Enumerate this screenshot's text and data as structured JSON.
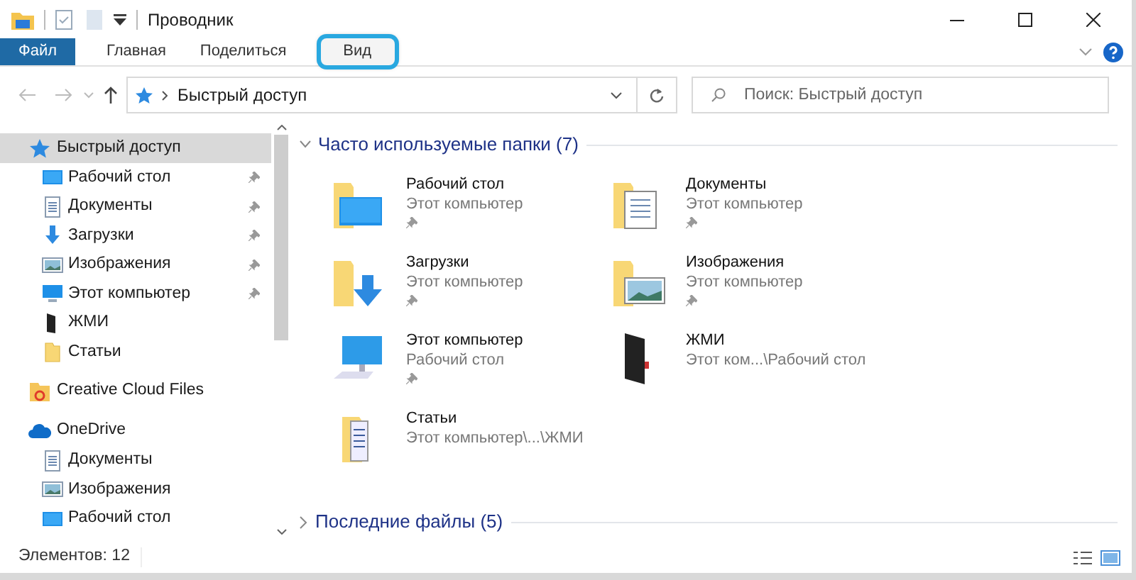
{
  "window": {
    "title": "Проводник"
  },
  "ribbon_tabs": [
    {
      "label": "Файл",
      "kind": "file",
      "highlighted": false
    },
    {
      "label": "Главная",
      "kind": "tab",
      "highlighted": false
    },
    {
      "label": "Поделиться",
      "kind": "tab",
      "highlighted": false
    },
    {
      "label": "Вид",
      "kind": "tab",
      "highlighted": true
    }
  ],
  "address_bar": {
    "path": "Быстрый доступ"
  },
  "search": {
    "placeholder": "Поиск: Быстрый доступ"
  },
  "sidebar": {
    "items": [
      {
        "label": "Быстрый доступ",
        "selected": true,
        "children": [
          {
            "label": "Рабочий стол",
            "pinned": true,
            "selected": false
          },
          {
            "label": "Документы",
            "pinned": true,
            "selected": false
          },
          {
            "label": "Загрузки",
            "pinned": true,
            "selected": false
          },
          {
            "label": "Изображения",
            "pinned": true,
            "selected": false
          },
          {
            "label": "Этот компьютер",
            "pinned": true,
            "selected": false
          },
          {
            "label": "ЖМИ",
            "pinned": false,
            "selected": false
          },
          {
            "label": "Статьи",
            "pinned": false,
            "selected": false
          }
        ]
      },
      {
        "label": "Creative Cloud Files",
        "selected": false
      },
      {
        "label": "OneDrive",
        "selected": false,
        "children": [
          {
            "label": "Документы",
            "pinned": false,
            "selected": false
          },
          {
            "label": "Изображения",
            "pinned": false,
            "selected": false
          },
          {
            "label": "Рабочий стол",
            "pinned": false,
            "selected": false
          }
        ]
      }
    ]
  },
  "sections": [
    {
      "title": "Часто используемые папки (7)",
      "expanded": true,
      "folders": [
        {
          "name": "Рабочий стол",
          "location": "Этот компьютер",
          "pinned": true
        },
        {
          "name": "Документы",
          "location": "Этот компьютер",
          "pinned": true
        },
        {
          "name": "Загрузки",
          "location": "Этот компьютер",
          "pinned": true
        },
        {
          "name": "Изображения",
          "location": "Этот компьютер",
          "pinned": true
        },
        {
          "name": "Этот компьютер",
          "location": "Рабочий стол",
          "pinned": true
        },
        {
          "name": "ЖМИ",
          "location": "Этот ком...\\Рабочий стол",
          "pinned": false
        },
        {
          "name": "Статьи",
          "location": "Этот компьютер\\...\\ЖМИ",
          "pinned": false
        }
      ]
    },
    {
      "title": "Последние файлы (5)",
      "expanded": false
    }
  ],
  "status_bar": {
    "text": "Элементов: 12"
  }
}
